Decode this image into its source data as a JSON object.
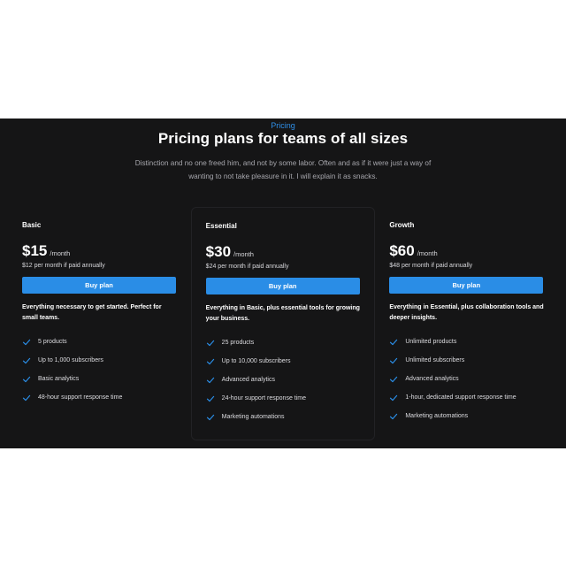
{
  "header": {
    "eyebrow": "Pricing",
    "title": "Pricing plans for teams of all sizes",
    "subtitle": "Distinction and no one freed him, and not by some labor. Often and as if it were just a way of wanting to not take pleasure in it. I will explain it as snacks."
  },
  "colors": {
    "accent": "#2a8de6",
    "background": "#151516",
    "check": "#2a8de6"
  },
  "plans": [
    {
      "name": "Basic",
      "price": "$15",
      "period": "/month",
      "annual_note": "$12 per month if paid annually",
      "button_label": "Buy plan",
      "description": "Everything necessary to get started. Perfect for small teams.",
      "features": [
        "5 products",
        "Up to 1,000 subscribers",
        "Basic analytics",
        "48-hour support response time"
      ]
    },
    {
      "name": "Essential",
      "price": "$30",
      "period": "/month",
      "annual_note": "$24 per month if paid annually",
      "button_label": "Buy plan",
      "description": "Everything in Basic, plus essential tools for growing your business.",
      "features": [
        "25 products",
        "Up to 10,000 subscribers",
        "Advanced analytics",
        "24-hour support response time",
        "Marketing automations"
      ]
    },
    {
      "name": "Growth",
      "price": "$60",
      "period": "/month",
      "annual_note": "$48 per month if paid annually",
      "button_label": "Buy plan",
      "description": "Everything in Essential, plus collaboration tools and deeper insights.",
      "features": [
        "Unlimited products",
        "Unlimited subscribers",
        "Advanced analytics",
        "1-hour, dedicated support response time",
        "Marketing automations"
      ]
    }
  ],
  "icons": {
    "feature_check": "check-icon"
  }
}
